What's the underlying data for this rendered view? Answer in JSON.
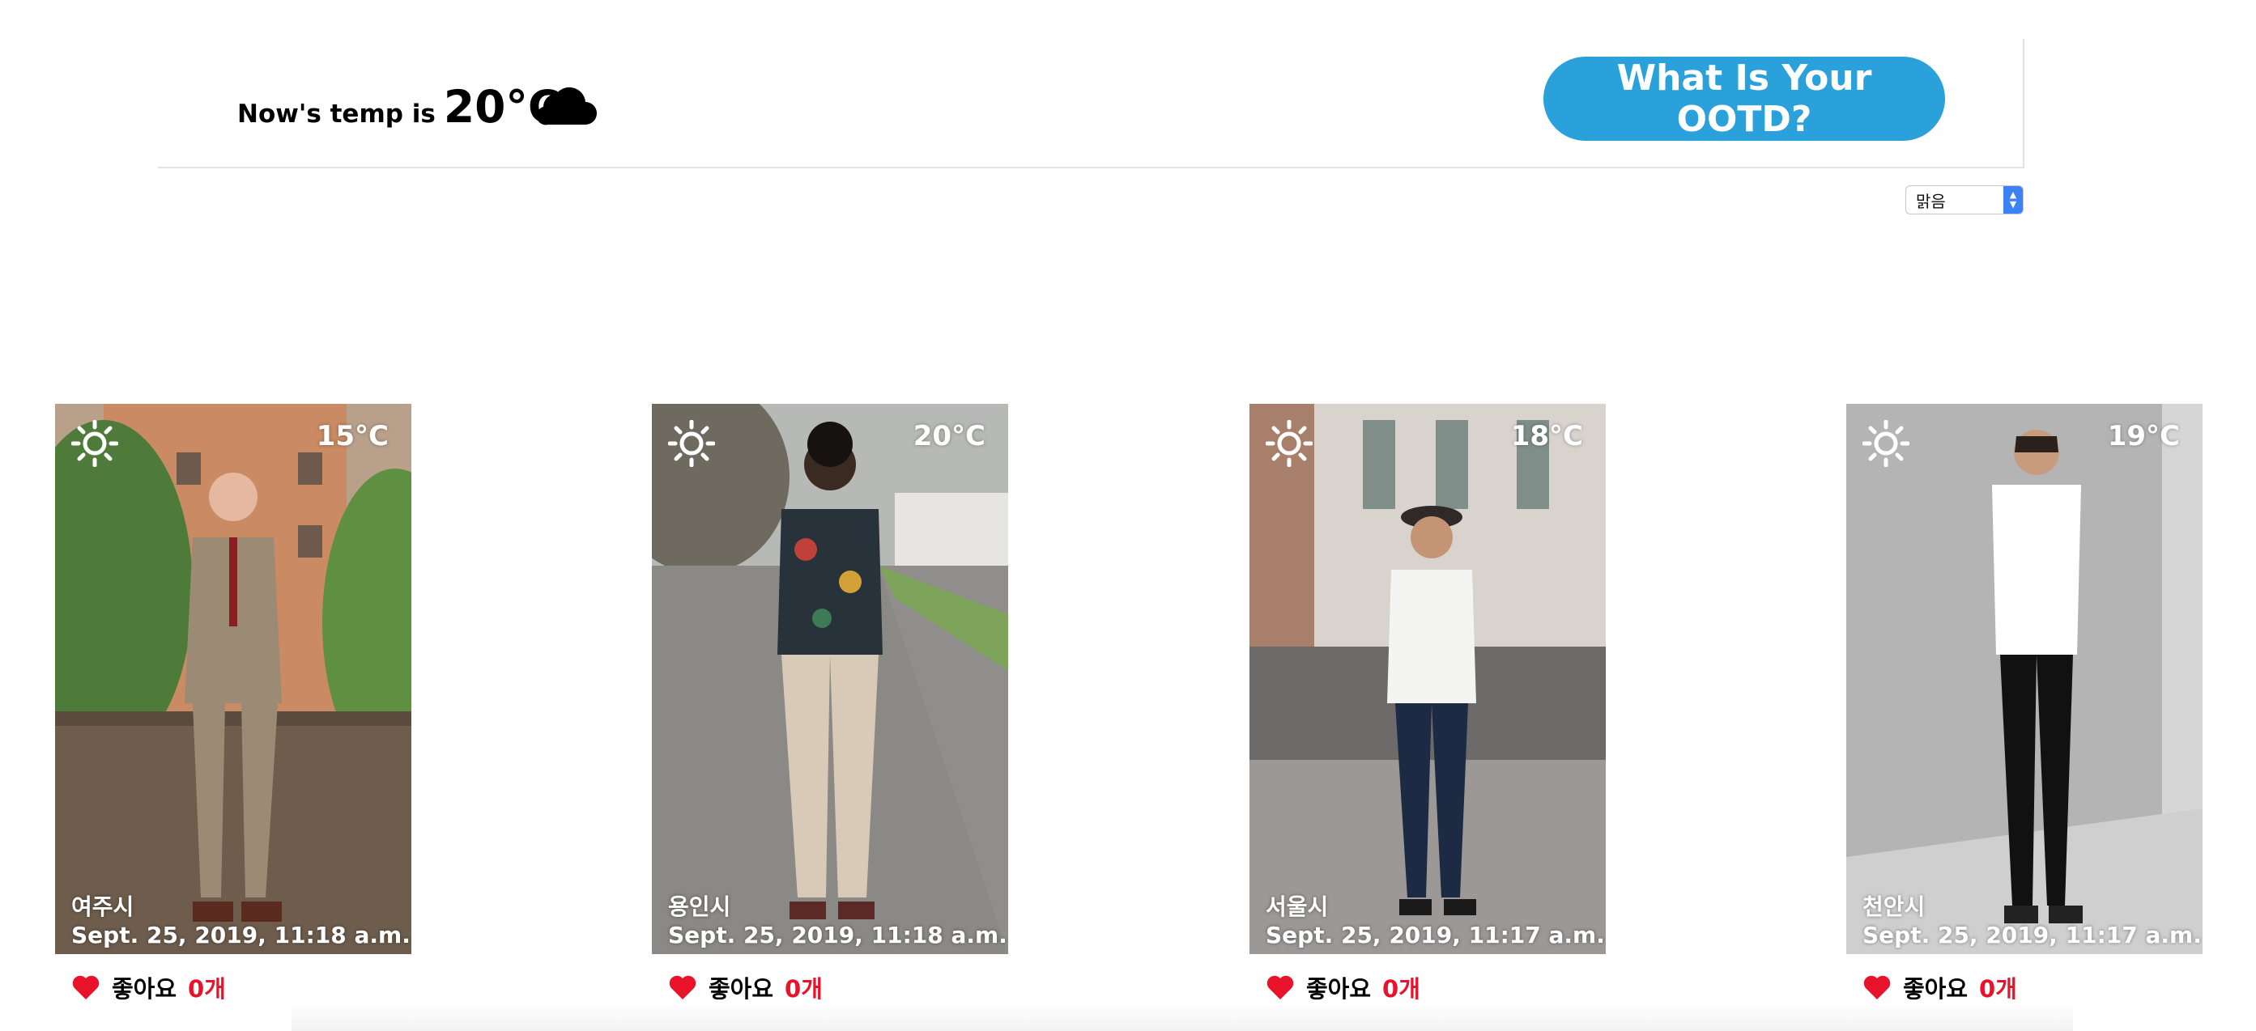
{
  "header": {
    "temp_prefix": "Now's temp is",
    "temp_value": "20°C",
    "weather_icon": "cloud-icon",
    "ootd_button_label": "What Is Your OOTD?"
  },
  "filter": {
    "selected": "맑음"
  },
  "cards": [
    {
      "weather_icon": "sun-icon",
      "temp": "15°C",
      "city": "여주시",
      "date": "Sept. 25, 2019, 11:18 a.m.",
      "like_label": "좋아요",
      "like_count": "0개"
    },
    {
      "weather_icon": "sun-icon",
      "temp": "20°C",
      "city": "용인시",
      "date": "Sept. 25, 2019, 11:18 a.m.",
      "like_label": "좋아요",
      "like_count": "0개"
    },
    {
      "weather_icon": "sun-icon",
      "temp": "18°C",
      "city": "서울시",
      "date": "Sept. 25, 2019, 11:17 a.m.",
      "like_label": "좋아요",
      "like_count": "0개"
    },
    {
      "weather_icon": "sun-icon",
      "temp": "19°C",
      "city": "천안시",
      "date": "Sept. 25, 2019, 11:17 a.m.",
      "like_label": "좋아요",
      "like_count": "0개"
    }
  ],
  "colors": {
    "accent": "#2aa1db",
    "heart": "#e8132b",
    "like_count": "#e8132b"
  }
}
